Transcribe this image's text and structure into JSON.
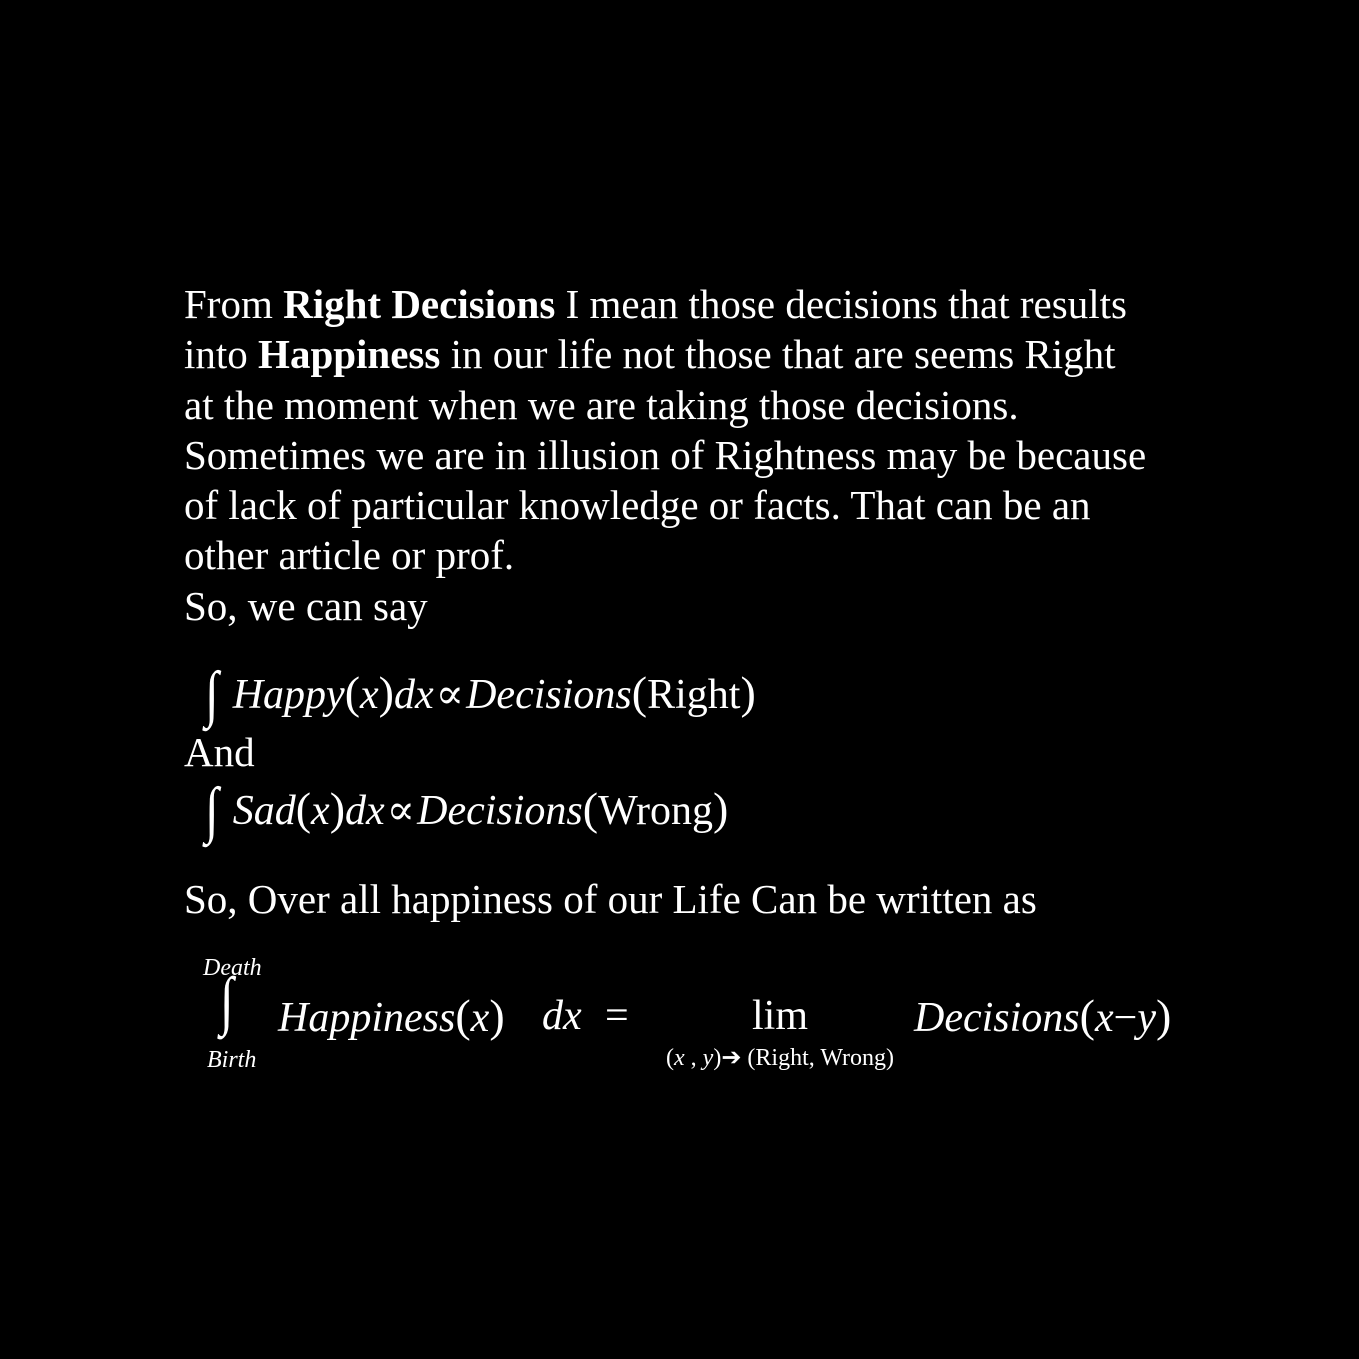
{
  "paragraph": {
    "l1_pre": "From ",
    "l1_bold": "Right Decisions",
    "l1_post": " I mean those decisions that results",
    "l2_pre": "into ",
    "l2_bold": "Happiness",
    "l2_post": " in our life not those that are seems Right",
    "l3": "at the moment when we are taking those decisions.",
    "l4": "Sometimes we are in illusion of Rightness may be because",
    "l5": "of lack of particular knowledge or facts. That can be an",
    "l6": "other article or prof.",
    "l7": "So, we can say"
  },
  "equation1": {
    "integral": "∫",
    "func": "Happy",
    "open": "(",
    "var": "x",
    "close": ")",
    "dx": "dx",
    "prop": "∝",
    "rhs_func": "Decisions",
    "rhs_arg": "Right"
  },
  "and_text": "And",
  "equation2": {
    "integral": "∫",
    "func": "Sad",
    "open": "(",
    "var": "x",
    "close": ")",
    "dx": "dx",
    "prop": "∝",
    "rhs_func": "Decisions",
    "rhs_arg": "Wrong"
  },
  "overall_text": "So, Over all happiness of our Life Can be written as",
  "equation3": {
    "upper": "Death",
    "integral": "∫",
    "lower": "Birth",
    "func": "Happiness",
    "open": "(",
    "var": "x",
    "close": ")",
    "dx": "dx",
    "equals": "=",
    "lim": "lim",
    "sub_open": "(",
    "sub_x": "x",
    "sub_comma": " , ",
    "sub_y": "y",
    "sub_close": ")",
    "arrow": "➔",
    "sub_target": " (Right, Wrong)",
    "rhs_func": "Decisions",
    "rhs_open": "(",
    "rhs_x": "x",
    "rhs_minus": "−",
    "rhs_y": "y",
    "rhs_close": ")"
  }
}
